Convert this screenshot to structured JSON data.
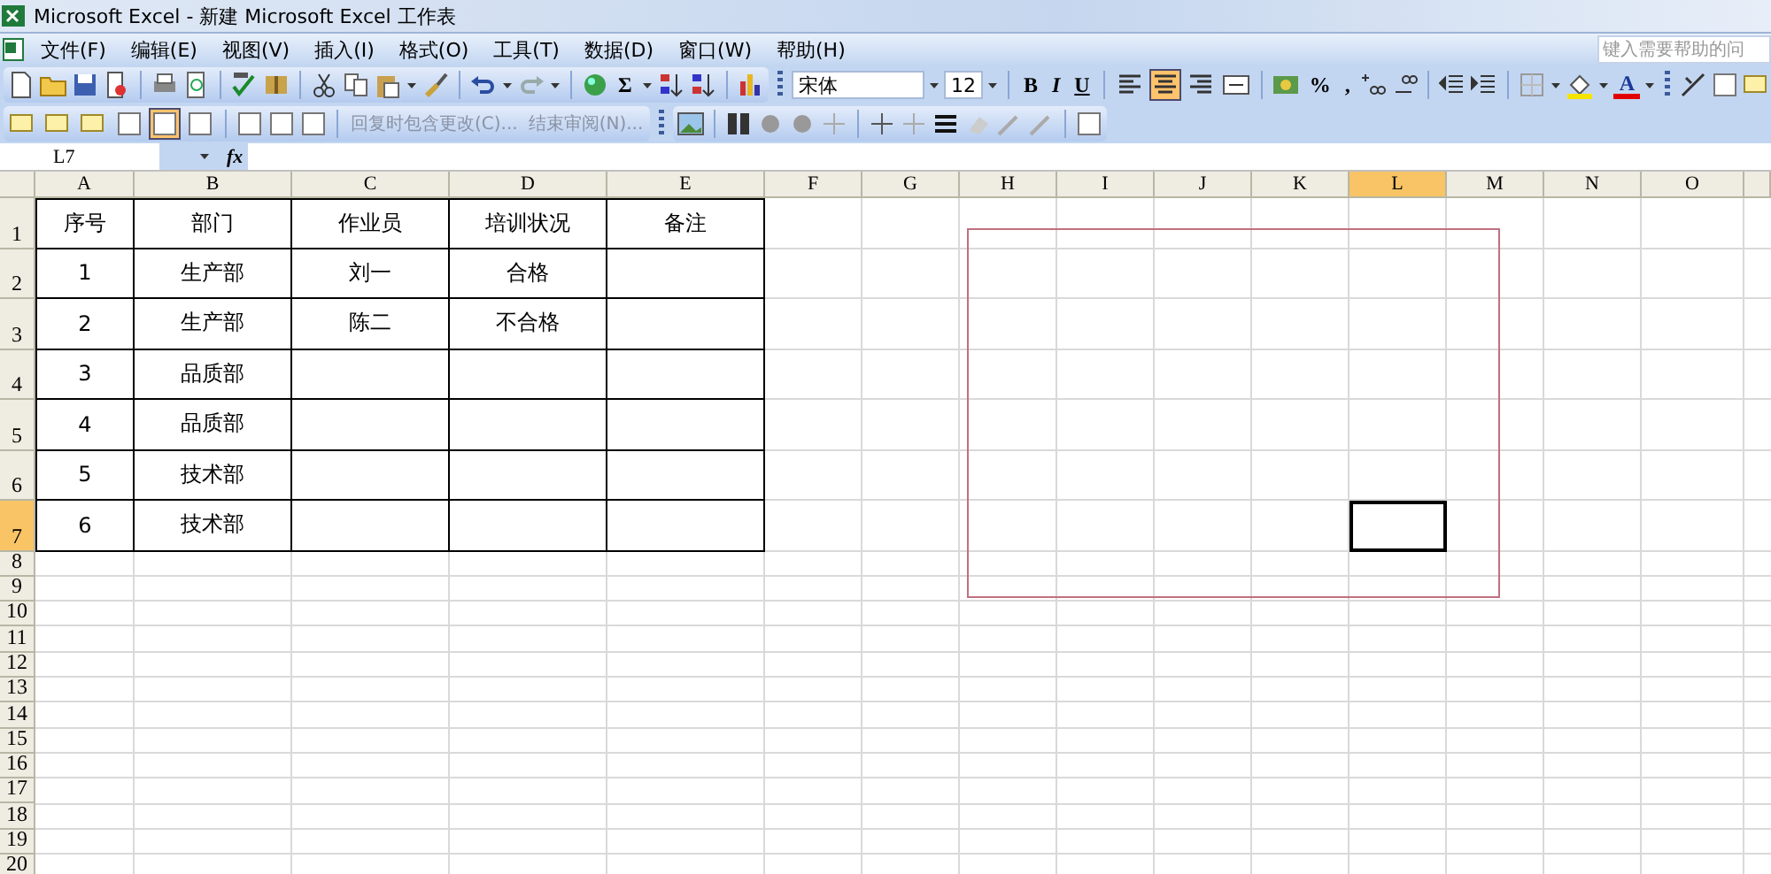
{
  "window": {
    "title": "Microsoft Excel - 新建 Microsoft Excel 工作表"
  },
  "menu": [
    "文件(F)",
    "编辑(E)",
    "视图(V)",
    "插入(I)",
    "格式(O)",
    "工具(T)",
    "数据(D)",
    "窗口(W)",
    "帮助(H)"
  ],
  "help_box": {
    "placeholder": "键入需要帮助的问"
  },
  "formatting": {
    "font": "宋体",
    "size": "12",
    "bold": "B",
    "italic": "I",
    "underline": "U",
    "sum": "Σ",
    "percent": "%",
    "comma": ",",
    "font_color": "A",
    "align": [
      {
        "selected": false
      },
      {
        "selected": true
      },
      {
        "selected": false
      },
      {
        "selected": false
      }
    ]
  },
  "reviewing": {
    "buttons": [
      {
        "on": false
      },
      {
        "on": false
      },
      {
        "on": false
      },
      {
        "on": false
      },
      {
        "on": true
      },
      {
        "on": false
      }
    ],
    "reply_label": "回复时包含更改(C)...",
    "end_label": "结束审阅(N)..."
  },
  "formula_bar": {
    "name_box": "L7",
    "fx": "fx"
  },
  "sheet": {
    "columns": [
      {
        "label": "A",
        "selected": false
      },
      {
        "label": "B",
        "selected": false
      },
      {
        "label": "C",
        "selected": false
      },
      {
        "label": "D",
        "selected": false
      },
      {
        "label": "E",
        "selected": false
      },
      {
        "label": "F",
        "selected": false
      },
      {
        "label": "G",
        "selected": false
      },
      {
        "label": "H",
        "selected": false
      },
      {
        "label": "I",
        "selected": false
      },
      {
        "label": "J",
        "selected": false
      },
      {
        "label": "K",
        "selected": false
      },
      {
        "label": "L",
        "selected": true
      },
      {
        "label": "M",
        "selected": false
      },
      {
        "label": "N",
        "selected": false
      },
      {
        "label": "O",
        "selected": false
      }
    ],
    "rows": [
      {
        "label": "1",
        "selected": false,
        "bordered": true,
        "cells": [
          "序号",
          "部门",
          "作业员",
          "培训状况",
          "备注"
        ]
      },
      {
        "label": "2",
        "selected": false,
        "bordered": true,
        "cells": [
          "1",
          "生产部",
          "刘一",
          "合格"
        ]
      },
      {
        "label": "3",
        "selected": false,
        "bordered": true,
        "cells": [
          "2",
          "生产部",
          "陈二",
          "不合格"
        ]
      },
      {
        "label": "4",
        "selected": false,
        "bordered": true,
        "cells": [
          "3",
          "品质部"
        ]
      },
      {
        "label": "5",
        "selected": false,
        "bordered": true,
        "cells": [
          "4",
          "品质部"
        ]
      },
      {
        "label": "6",
        "selected": false,
        "bordered": true,
        "cells": [
          "5",
          "技术部"
        ]
      },
      {
        "label": "7",
        "selected": true,
        "bordered": true,
        "cells": [
          "6",
          "技术部"
        ]
      },
      {
        "label": "8",
        "selected": false,
        "bordered": false
      },
      {
        "label": "9",
        "selected": false,
        "bordered": false
      },
      {
        "label": "10",
        "selected": false,
        "bordered": false
      },
      {
        "label": "11",
        "selected": false,
        "bordered": false
      },
      {
        "label": "12",
        "selected": false,
        "bordered": false
      },
      {
        "label": "13",
        "selected": false,
        "bordered": false
      },
      {
        "label": "14",
        "selected": false,
        "bordered": false
      },
      {
        "label": "15",
        "selected": false,
        "bordered": false
      },
      {
        "label": "16",
        "selected": false,
        "bordered": false
      },
      {
        "label": "17",
        "selected": false,
        "bordered": false
      },
      {
        "label": "18",
        "selected": false,
        "bordered": false
      },
      {
        "label": "19",
        "selected": false,
        "bordered": false
      },
      {
        "label": "20",
        "selected": false,
        "bordered": false
      }
    ],
    "shapes": [
      {
        "kind": "rectangle"
      }
    ]
  }
}
